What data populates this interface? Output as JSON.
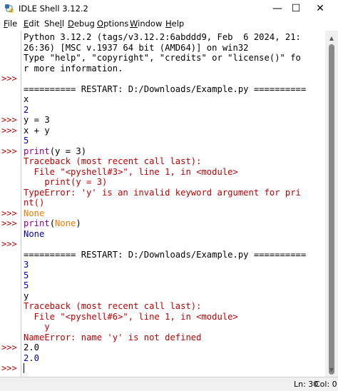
{
  "window": {
    "title": "IDLE Shell 3.12.2"
  },
  "controls": {
    "minimize": "—",
    "maximize": "☐",
    "close": "✕"
  },
  "menu": [
    {
      "label": "File",
      "ul": "F",
      "rest": "ile"
    },
    {
      "label": "Edit",
      "ul": "E",
      "rest": "dit"
    },
    {
      "label": "Shell",
      "pre": "She",
      "ul": "l",
      "rest": "l"
    },
    {
      "label": "Debug",
      "ul": "D",
      "rest": "ebug"
    },
    {
      "label": "Options",
      "ul": "O",
      "rest": "ptions"
    },
    {
      "label": "Window",
      "ul": "W",
      "rest": "indow"
    },
    {
      "label": "Help",
      "ul": "H",
      "rest": "elp"
    }
  ],
  "prompt_text": ">>>",
  "shell_lines": [
    [
      {
        "t": "Python 3.12.2 (tags/v3.12.2:6abddd9, Feb  6 2024, 21:",
        "c": "def"
      }
    ],
    [
      {
        "t": "26:36) [MSC v.1937 64 bit (AMD64)] on win32",
        "c": "def"
      }
    ],
    [
      {
        "t": "Type \"help\", \"copyright\", \"credits\" or \"license()\" fo",
        "c": "def"
      }
    ],
    [
      {
        "t": "r more information.",
        "c": "def"
      }
    ],
    [],
    [
      {
        "t": "========== RESTART: D:/Downloads/Example.py ==========",
        "c": "def"
      }
    ],
    [
      {
        "t": "x",
        "c": "def"
      }
    ],
    [
      {
        "t": "2",
        "c": "out"
      }
    ],
    [
      {
        "t": "y = 3",
        "c": "def"
      }
    ],
    [
      {
        "t": "x + y",
        "c": "def"
      }
    ],
    [
      {
        "t": "5",
        "c": "out"
      }
    ],
    [
      {
        "t": "print",
        "c": "kw"
      },
      {
        "t": "(y = 3)",
        "c": "def"
      }
    ],
    [
      {
        "t": "Traceback (most recent call last):",
        "c": "err"
      }
    ],
    [
      {
        "t": "  File \"<pyshell#3>\", line 1, in <module>",
        "c": "err"
      }
    ],
    [
      {
        "t": "    print(y = 3)",
        "c": "err"
      }
    ],
    [
      {
        "t": "TypeError: 'y' is an invalid keyword argument for pri",
        "c": "err"
      }
    ],
    [
      {
        "t": "nt()",
        "c": "err"
      }
    ],
    [
      {
        "t": "None",
        "c": "none"
      }
    ],
    [
      {
        "t": "print",
        "c": "kw"
      },
      {
        "t": "(",
        "c": "def"
      },
      {
        "t": "None",
        "c": "none"
      },
      {
        "t": ")",
        "c": "def"
      }
    ],
    [
      {
        "t": "None",
        "c": "out"
      }
    ],
    [],
    [
      {
        "t": "========== RESTART: D:/Downloads/Example.py ==========",
        "c": "def"
      }
    ],
    [
      {
        "t": "3",
        "c": "out"
      }
    ],
    [
      {
        "t": "5",
        "c": "out"
      }
    ],
    [
      {
        "t": "5",
        "c": "out"
      }
    ],
    [
      {
        "t": "y",
        "c": "def"
      }
    ],
    [
      {
        "t": "Traceback (most recent call last):",
        "c": "err"
      }
    ],
    [
      {
        "t": "  File \"<pyshell#6>\", line 1, in <module>",
        "c": "err"
      }
    ],
    [
      {
        "t": "    y",
        "c": "err"
      }
    ],
    [
      {
        "t": "NameError: name 'y' is not defined",
        "c": "err"
      }
    ],
    [
      {
        "t": "2.0",
        "c": "def"
      }
    ],
    [
      {
        "t": "2.0",
        "c": "out"
      }
    ],
    []
  ],
  "prompt_lines": [
    4,
    8,
    9,
    11,
    17,
    18,
    20,
    30,
    32
  ],
  "status": {
    "line": "Ln: 30",
    "col": "Col: 0"
  },
  "colors": {
    "prompt": "#c00000",
    "stdout": "#0000c0",
    "stderr": "#c00000",
    "builtin": "#900090",
    "none_keyword": "#ff7700"
  }
}
